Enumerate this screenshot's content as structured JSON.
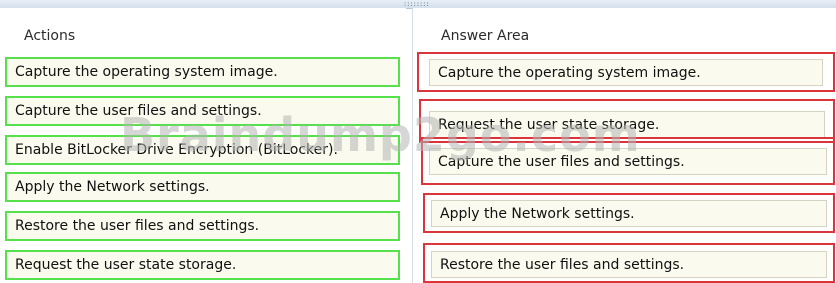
{
  "left_pane": {
    "header": "Actions",
    "items": [
      "Capture the operating system image.",
      "Capture the user files and settings.",
      "Enable BitLocker Drive Encryption (BitLocker).",
      "Apply the Network settings.",
      "Restore the user files and settings.",
      "Request the user state storage."
    ]
  },
  "right_pane": {
    "header": "Answer Area",
    "items": [
      "Capture the operating system image.",
      "Request the user state storage.",
      "Capture the user files and settings.",
      "Apply the Network settings.",
      "Restore the user files and settings."
    ]
  },
  "watermark": "Braindump2go.com",
  "colors": {
    "action_border": "#55e04c",
    "slot_border": "#d9353a",
    "item_fill": "#fbfaee"
  }
}
